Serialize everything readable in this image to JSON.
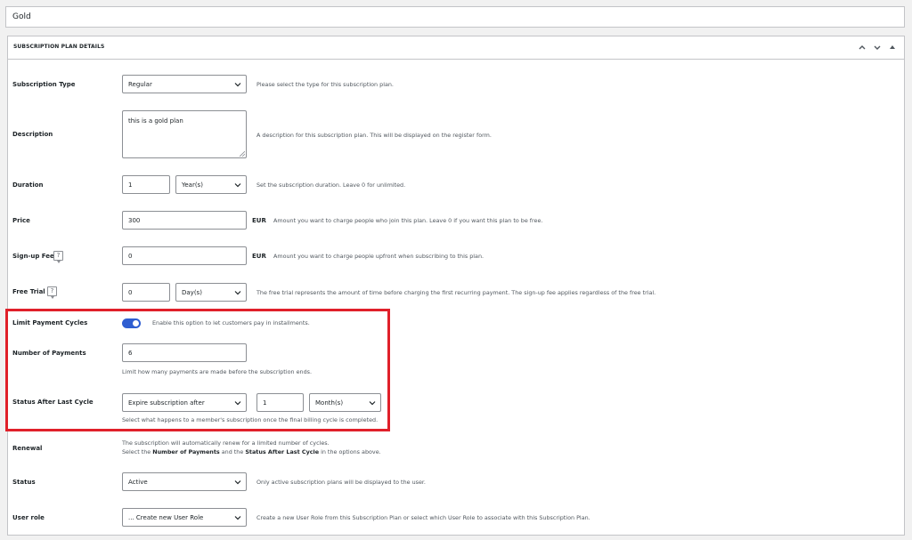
{
  "plan_name": "Gold",
  "panel": {
    "title": "SUBSCRIPTION PLAN DETAILS",
    "icons": [
      "chevron-up-icon",
      "chevron-down-icon",
      "collapse-triangle-icon"
    ]
  },
  "subscription_type": {
    "label": "Subscription Type",
    "value": "Regular",
    "help": "Please select the type for this subscription plan."
  },
  "description": {
    "label": "Description",
    "value": "this is a gold plan",
    "help": "A description for this subscription plan. This will be displayed on the register form."
  },
  "duration": {
    "label": "Duration",
    "value": "1",
    "unit": "Year(s)",
    "help": "Set the subscription duration. Leave 0 for unlimited."
  },
  "price": {
    "label": "Price",
    "value": "300",
    "currency": "EUR",
    "help": "Amount you want to charge people who join this plan. Leave 0 if you want this plan to be free."
  },
  "signup_fee": {
    "label": "Sign-up Fee",
    "help_icon": "?",
    "value": "0",
    "currency": "EUR",
    "help": "Amount you want to charge people upfront when subscribing to this plan."
  },
  "free_trial": {
    "label": "Free Trial",
    "help_icon": "?",
    "value": "0",
    "unit": "Day(s)",
    "help": "The free trial represents the amount of time before charging the first recurring payment. The sign-up fee applies regardless of the free trial."
  },
  "limit_payment_cycles": {
    "label": "Limit Payment Cycles",
    "enabled": true,
    "help": "Enable this option to let customers pay in installments."
  },
  "number_of_payments": {
    "label": "Number of Payments",
    "value": "6",
    "help": "Limit how many payments are made before the subscription ends."
  },
  "status_after_last_cycle": {
    "label": "Status After Last Cycle",
    "action": "Expire subscription after",
    "amount": "1",
    "unit": "Month(s)",
    "help": "Select what happens to a member's subscription once the final billing cycle is completed."
  },
  "renewal": {
    "label": "Renewal",
    "line1": "The subscription will automatically renew for a limited number of cycles.",
    "line2_pre": "Select the ",
    "line2_b1": "Number of Payments",
    "line2_mid": " and the ",
    "line2_b2": "Status After Last Cycle",
    "line2_post": " in the options above."
  },
  "status": {
    "label": "Status",
    "value": "Active",
    "help": "Only active subscription plans will be displayed to the user."
  },
  "user_role": {
    "label": "User role",
    "value": "... Create new User Role",
    "help": "Create a new User Role from this Subscription Plan or select which User Role to associate with this Subscription Plan."
  },
  "colors": {
    "toggle_on": "#2f5ed1",
    "highlight_border": "#e0202a"
  }
}
